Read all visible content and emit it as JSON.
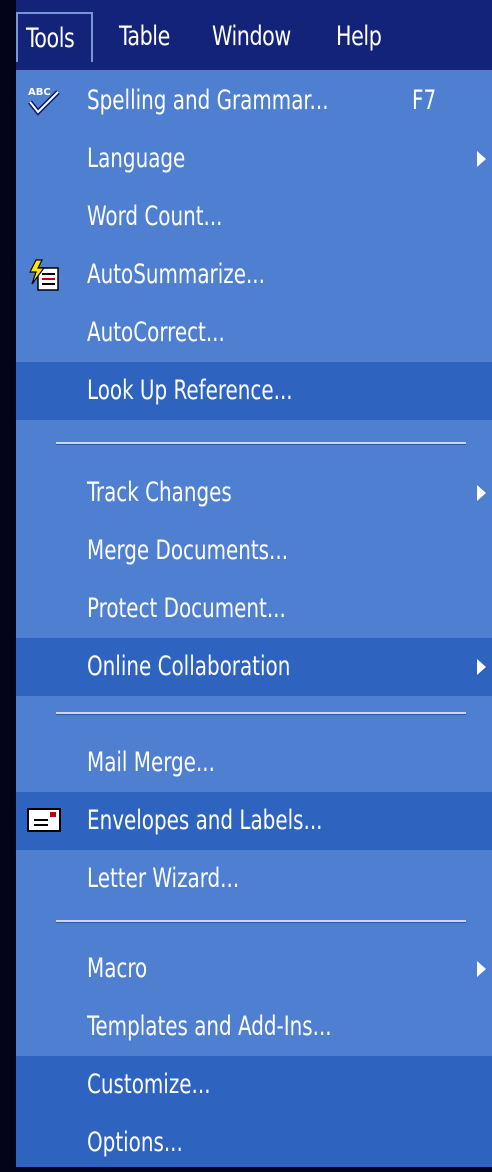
{
  "menubar": {
    "items": [
      {
        "label": "Tools"
      },
      {
        "label": "Table"
      },
      {
        "label": "Window"
      },
      {
        "label": "Help"
      }
    ]
  },
  "menu": {
    "items": [
      {
        "label": "Spelling and Grammar...",
        "shortcut": "F7",
        "icon": "spelling-abc-check-icon"
      },
      {
        "label": "Language",
        "submenu": true
      },
      {
        "label": "Word Count..."
      },
      {
        "label": "AutoSummarize...",
        "icon": "autosummarize-icon"
      },
      {
        "label": "AutoCorrect..."
      },
      {
        "label": "Look Up Reference..."
      },
      {
        "label": "Track Changes",
        "submenu": true
      },
      {
        "label": "Merge Documents..."
      },
      {
        "label": "Protect Document..."
      },
      {
        "label": "Online Collaboration",
        "submenu": true
      },
      {
        "label": "Mail Merge..."
      },
      {
        "label": "Envelopes and Labels...",
        "icon": "envelope-icon"
      },
      {
        "label": "Letter Wizard..."
      },
      {
        "label": "Macro",
        "submenu": true
      },
      {
        "label": "Templates and Add-Ins..."
      },
      {
        "label": "Customize..."
      },
      {
        "label": "Options..."
      }
    ]
  },
  "colors": {
    "menu_background": "#4f7fd0",
    "menu_row_dark": "#2e63c0",
    "menubar_background": "#14237a",
    "text": "#ffffff"
  }
}
